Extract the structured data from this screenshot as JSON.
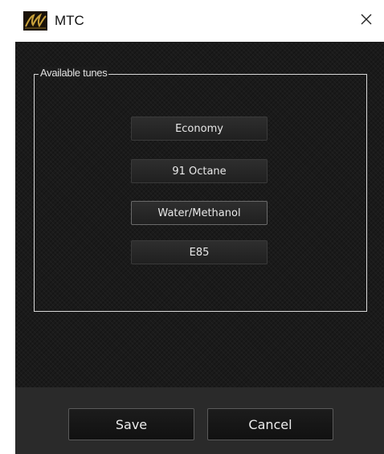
{
  "window": {
    "title": "MTC",
    "icon": "mtc-logo-icon",
    "close_icon": "close-icon"
  },
  "group": {
    "label": "Available tunes",
    "tunes": [
      {
        "label": "Economy",
        "selected": false
      },
      {
        "label": "91 Octane",
        "selected": false
      },
      {
        "label": "Water/Methanol",
        "selected": true
      },
      {
        "label": "E85",
        "selected": false
      }
    ]
  },
  "footer": {
    "save_label": "Save",
    "cancel_label": "Cancel"
  },
  "colors": {
    "background": "#1a1a1a",
    "footer": "#2a2a2a",
    "text": "#e8e8e8",
    "logo_gold": "#c9a13b"
  }
}
